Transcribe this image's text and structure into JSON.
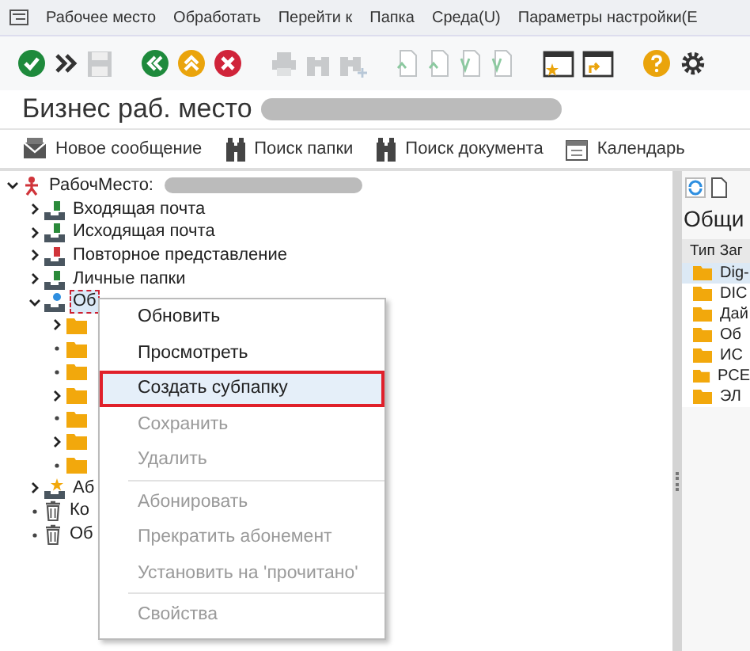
{
  "menu_bar": [
    "Рабочее место",
    "Обработать",
    "Перейти к",
    "Папка",
    "Среда(U)",
    "Параметры настройки(E"
  ],
  "title": {
    "text": "Бизнес раб. место",
    "redacted": true
  },
  "app_toolbar": [
    "Новое сообщение",
    "Поиск папки",
    "Поиск документа",
    "Календарь"
  ],
  "tree": {
    "label": "РабочМесто:",
    "redacted": true,
    "expandable": true,
    "expanded": true,
    "selected": false,
    "children": [
      {
        "label": "Входящая почта",
        "expandable": true,
        "expanded": false,
        "selected": false
      },
      {
        "label": "Исходящая почта",
        "expandable": true,
        "expanded": false,
        "selected": false
      },
      {
        "label": "Повторное представление",
        "expandable": true,
        "expanded": false,
        "selected": false
      },
      {
        "label": "Личные папки",
        "expandable": true,
        "expanded": false,
        "selected": false
      },
      {
        "label": "Об",
        "expandable": true,
        "expanded": true,
        "selected": true,
        "children": [
          {
            "expandable": true,
            "expanded": false
          },
          {
            "expandable": false
          },
          {
            "expandable": false
          },
          {
            "expandable": true,
            "expanded": false
          },
          {
            "expandable": false
          },
          {
            "expandable": true,
            "expanded": false
          },
          {
            "expandable": false
          }
        ]
      },
      {
        "label": "Аб",
        "expandable": true,
        "expanded": false,
        "selected": false
      },
      {
        "label": "Ко",
        "expandable": false,
        "selected": false
      },
      {
        "label": "Об",
        "expandable": false,
        "selected": false
      }
    ]
  },
  "context_menu": [
    {
      "label": "Обновить",
      "disabled": false,
      "highlighted": false,
      "separator_before": false
    },
    {
      "label": "Просмотреть",
      "disabled": false,
      "highlighted": false,
      "separator_before": false
    },
    {
      "label": "Создать субпапку",
      "disabled": false,
      "highlighted": true,
      "separator_before": false
    },
    {
      "label": "Сохранить",
      "disabled": true,
      "highlighted": false,
      "separator_before": false
    },
    {
      "label": "Удалить",
      "disabled": true,
      "highlighted": false,
      "separator_before": false
    },
    {
      "label": "Абонировать",
      "disabled": true,
      "highlighted": false,
      "separator_before": true
    },
    {
      "label": "Прекратить абонемент",
      "disabled": true,
      "highlighted": false,
      "separator_before": false
    },
    {
      "label": "Установить на 'прочитано'",
      "disabled": true,
      "highlighted": false,
      "separator_before": false
    },
    {
      "label": "Свойства",
      "disabled": true,
      "highlighted": false,
      "separator_before": true
    }
  ],
  "right_panel": {
    "title": "Общи",
    "columns": [
      "Тип",
      "Заг"
    ],
    "rows": [
      {
        "name": "Dig-",
        "selected": true
      },
      {
        "name": "DIC",
        "selected": false
      },
      {
        "name": "Дай",
        "selected": false
      },
      {
        "name": "Об",
        "selected": false
      },
      {
        "name": "ИС",
        "selected": false
      },
      {
        "name": "РСЕ",
        "selected": false
      },
      {
        "name": "ЭЛ",
        "selected": false
      }
    ]
  }
}
